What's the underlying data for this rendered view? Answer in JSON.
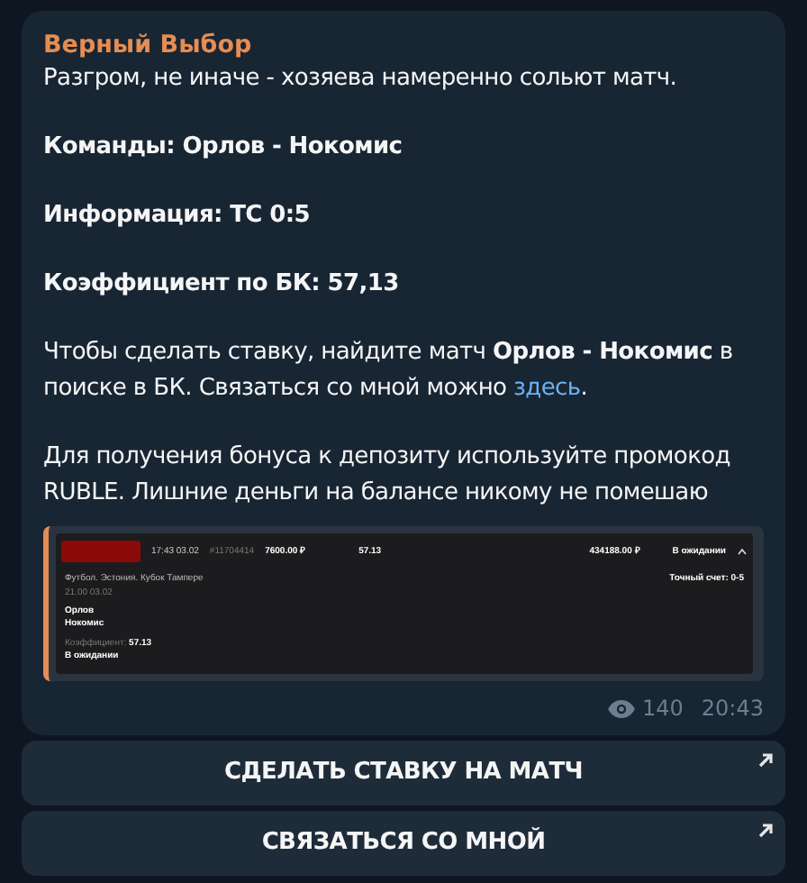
{
  "message": {
    "author": "Верный Выбор",
    "paragraphs": [
      {
        "kind": "plain",
        "text": "Разгром, не иначе - хозяева намеренно сольют матч."
      },
      {
        "kind": "bold",
        "text": "Команды: Орлов - Нокомис"
      },
      {
        "kind": "bold",
        "text": "Информация: ТС 0:5"
      },
      {
        "kind": "bold",
        "text": "Коэффициент по БК: 57,13"
      },
      {
        "kind": "plain",
        "text": "Чтобы сделать ставку, найдите матч **Орлов - Нокомис** в поиске в БК. Связаться со мной можно ",
        "link": "здесь",
        "after": "."
      },
      {
        "kind": "plain",
        "text": "Для получения бонуса к депозиту используйте промокод RUBLE. Лишние деньги на балансе никому не помешаю"
      }
    ],
    "bet_screenshot": {
      "time": "17:43 03.02",
      "id": "#11704414",
      "stake": "7600.00 ₽",
      "odds": "57.13",
      "payout": "434188.00 ₽",
      "status": "В ожидании",
      "league": "Футбол. Эстония. Кубок Тампере",
      "date": "21.00 03.02",
      "team_1": "Орлов",
      "team_2": "Нокомис",
      "market": "Точный счет: 0-5",
      "odds_label": "Коэффициент:",
      "odds_value": "57.13",
      "status_2": "В ожидании"
    },
    "views": "140",
    "time": "20:43"
  },
  "buttons": [
    {
      "label": "СДЕЛАТЬ СТАВКУ НА МАТЧ"
    },
    {
      "label": "СВЯЗАТЬСЯ СО МНОЙ"
    }
  ]
}
